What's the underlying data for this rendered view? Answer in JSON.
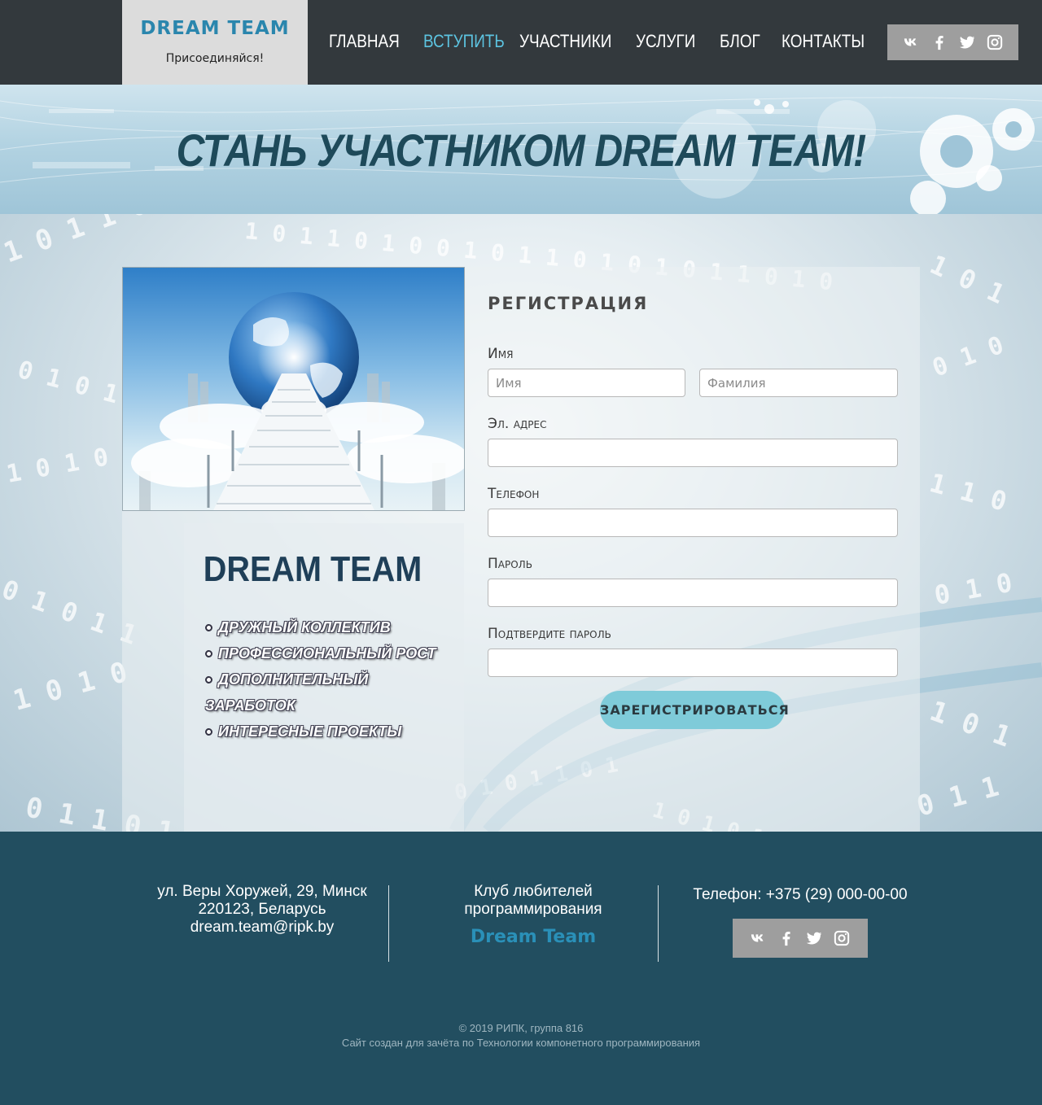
{
  "header": {
    "logo_title": "DREAM TEAM",
    "logo_subtitle": "Присоединяйся!",
    "nav": [
      {
        "label": "ГЛАВНАЯ",
        "active": false
      },
      {
        "label": "ВСТУПИТЬ",
        "active": true
      },
      {
        "label": "УЧАСТНИКИ",
        "active": false
      },
      {
        "label": "УСЛУГИ",
        "active": false
      },
      {
        "label": "БЛОГ",
        "active": false
      },
      {
        "label": "КОНТАКТЫ",
        "active": false
      }
    ],
    "social_icons": [
      "vk-icon",
      "facebook-icon",
      "twitter-icon",
      "instagram-icon"
    ]
  },
  "banner": {
    "title": "СТАНЬ УЧАСТНИКОМ  DREAM TEAM!"
  },
  "promo": {
    "title": "DREAM TEAM",
    "features": [
      "ДРУЖНЫЙ КОЛЛЕКТИВ",
      "ПРОФЕССИОНАЛЬНЫЙ РОСТ",
      "ДОПОЛНИТЕЛЬНЫЙ ЗАРАБОТОК",
      "ИНТЕРЕСНЫЕ ПРОЕКТЫ"
    ]
  },
  "form": {
    "title": "РЕГИСТРАЦИЯ",
    "name_label": "Имя",
    "first_name_placeholder": "Имя",
    "last_name_placeholder": "Фамилия",
    "email_label": "Эл. адрес",
    "phone_label": "Телефон",
    "password_label": "Пароль",
    "confirm_label": "Подтвердите пароль",
    "submit_label": "ЗАРЕГИСТРИРОВАТЬСЯ"
  },
  "footer": {
    "address_line1": "ул. Веры Хоружей, 29, Минск",
    "address_line2": "220123, Беларусь",
    "email": "dream.team@ripk.by",
    "club_line1": "Клуб любителей",
    "club_line2": "программирования",
    "brand": "Dream Team",
    "phone": "Телефон: +375 (29) 000-00-00",
    "copyright": "© 2019 РИПК, группа 816",
    "note": "Сайт создан для зачёта по Технологии компонетного программирования"
  },
  "colors": {
    "header_bg": "#33393d",
    "accent": "#5cc3e0",
    "brand_blue": "#2a86ad",
    "footer_bg": "#224e60",
    "button_bg": "#7fcbd9"
  }
}
